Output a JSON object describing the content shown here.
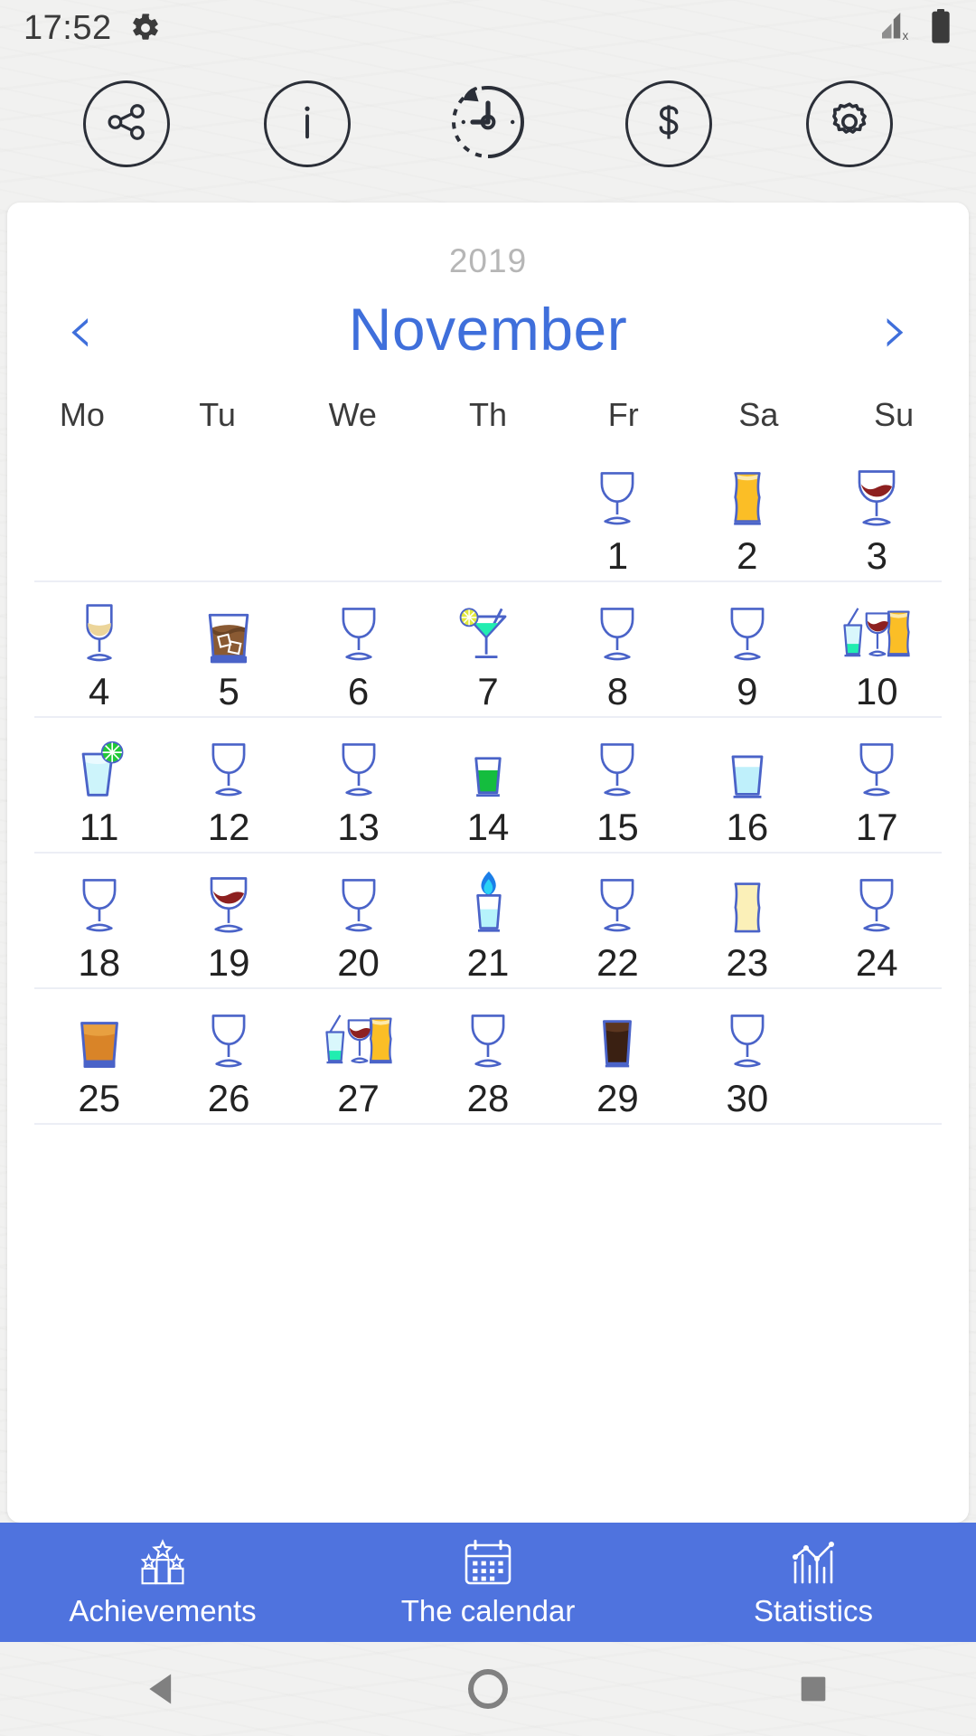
{
  "status_bar": {
    "time": "17:52",
    "gear_icon": "gear-icon",
    "signal_icon": "signal-no-service-icon",
    "battery_icon": "battery-full-icon"
  },
  "toolbar": {
    "buttons": [
      {
        "name": "share-button",
        "icon": "share-icon",
        "label": "Share"
      },
      {
        "name": "info-button",
        "icon": "info-icon",
        "label": "Info"
      },
      {
        "name": "reset-timer-button",
        "icon": "reset-clock-icon",
        "label": "Reset timer"
      },
      {
        "name": "price-button",
        "icon": "dollar-icon",
        "label": "Price"
      },
      {
        "name": "settings-button",
        "icon": "settings-gear-icon",
        "label": "Settings"
      }
    ]
  },
  "calendar": {
    "year": "2019",
    "month": "November",
    "prev_label": "‹",
    "next_label": "›",
    "weekdays": [
      "Mo",
      "Tu",
      "We",
      "Th",
      "Fr",
      "Sa",
      "Su"
    ],
    "accent_color": "#3f6fdb",
    "grid": [
      [
        {
          "day": "",
          "drink": "none"
        },
        {
          "day": "",
          "drink": "none"
        },
        {
          "day": "",
          "drink": "none"
        },
        {
          "day": "",
          "drink": "none"
        },
        {
          "day": "1",
          "drink": "snifter-empty"
        },
        {
          "day": "2",
          "drink": "beer-amber"
        },
        {
          "day": "3",
          "drink": "wine-red"
        }
      ],
      [
        {
          "day": "4",
          "drink": "wine-white"
        },
        {
          "day": "5",
          "drink": "whiskey-rocks"
        },
        {
          "day": "6",
          "drink": "snifter-empty"
        },
        {
          "day": "7",
          "drink": "cocktail-green"
        },
        {
          "day": "8",
          "drink": "snifter-empty"
        },
        {
          "day": "9",
          "drink": "snifter-empty"
        },
        {
          "day": "10",
          "drink": "multi-drinks"
        }
      ],
      [
        {
          "day": "11",
          "drink": "highball-lime"
        },
        {
          "day": "12",
          "drink": "snifter-empty"
        },
        {
          "day": "13",
          "drink": "snifter-empty"
        },
        {
          "day": "14",
          "drink": "shot-green"
        },
        {
          "day": "15",
          "drink": "snifter-empty"
        },
        {
          "day": "16",
          "drink": "glass-lightblue"
        },
        {
          "day": "17",
          "drink": "snifter-empty"
        }
      ],
      [
        {
          "day": "18",
          "drink": "snifter-empty"
        },
        {
          "day": "19",
          "drink": "wine-red"
        },
        {
          "day": "20",
          "drink": "snifter-empty"
        },
        {
          "day": "21",
          "drink": "shot-flaming"
        },
        {
          "day": "22",
          "drink": "snifter-empty"
        },
        {
          "day": "23",
          "drink": "glass-paleyellow"
        },
        {
          "day": "24",
          "drink": "snifter-empty"
        }
      ],
      [
        {
          "day": "25",
          "drink": "tumbler-orange"
        },
        {
          "day": "26",
          "drink": "snifter-empty"
        },
        {
          "day": "27",
          "drink": "multi-drinks"
        },
        {
          "day": "28",
          "drink": "snifter-empty"
        },
        {
          "day": "29",
          "drink": "glass-darkbrown"
        },
        {
          "day": "30",
          "drink": "snifter-empty"
        },
        {
          "day": "",
          "drink": "none"
        }
      ]
    ]
  },
  "bottom_nav": {
    "background_color": "#4f73de",
    "items": [
      {
        "label": "Achievements",
        "icon": "podium-trophy-icon",
        "name": "nav-achievements"
      },
      {
        "label": "The calendar",
        "icon": "calendar-icon",
        "name": "nav-calendar"
      },
      {
        "label": "Statistics",
        "icon": "chart-icon",
        "name": "nav-statistics"
      }
    ]
  },
  "system_nav": {
    "back_label": "Back",
    "home_label": "Home",
    "recents_label": "Recents"
  }
}
